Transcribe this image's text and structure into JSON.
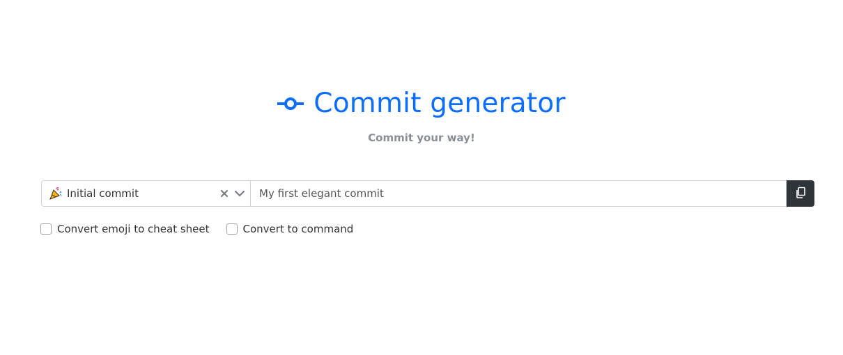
{
  "header": {
    "title": "Commit generator",
    "icon": "git-commit-icon",
    "subtitle": "Commit your way!"
  },
  "commit_type": {
    "emoji_icon": "party-popper-icon",
    "selected_label": "Initial commit",
    "clear_icon": "close-icon",
    "dropdown_icon": "chevron-down-icon"
  },
  "message": {
    "placeholder": "My first elegant commit"
  },
  "copy_button": {
    "icon": "copy-icon"
  },
  "options": [
    {
      "label": "Convert emoji to cheat sheet",
      "checked": false
    },
    {
      "label": "Convert to command",
      "checked": false
    }
  ],
  "colors": {
    "accent": "#0d6efd",
    "subtitle": "#8a8f94",
    "copy_button_bg": "#2f3439",
    "border": "#cfd4d9"
  }
}
